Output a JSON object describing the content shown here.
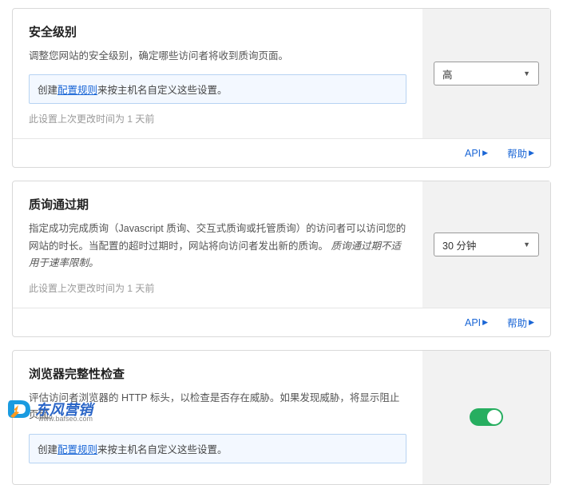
{
  "cards": [
    {
      "title": "安全级别",
      "desc": "调整您网站的安全级别，确定哪些访问者将收到质询页面。",
      "notePrefix": "创建",
      "noteLink": "配置规则",
      "noteSuffix": "来按主机名自定义这些设置。",
      "lastMod": "此设置上次更改时间为 1 天前",
      "control": {
        "type": "select",
        "value": "高"
      }
    },
    {
      "title": "质询通过期",
      "desc": "指定成功完成质询（Javascript 质询、交互式质询或托管质询）的访问者可以访问您的网站的时长。当配置的超时过期时，网站将向访问者发出新的质询。",
      "descItalic": "质询通过期不适用于速率限制。",
      "lastMod": "此设置上次更改时间为 1 天前",
      "control": {
        "type": "select",
        "value": "30 分钟"
      }
    },
    {
      "title": "浏览器完整性检查",
      "desc": "评估访问者浏览器的 HTTP 标头，以检查是否存在威胁。如果发现威胁，将显示阻止页面。",
      "notePrefix": "创建",
      "noteLink": "配置规则",
      "noteSuffix": "来按主机名自定义这些设置。",
      "control": {
        "type": "toggle",
        "value": true
      }
    }
  ],
  "footer": {
    "api": "API",
    "help": "帮助"
  },
  "watermark": {
    "brand": "东风营销",
    "url": "www.bafseo.com"
  }
}
